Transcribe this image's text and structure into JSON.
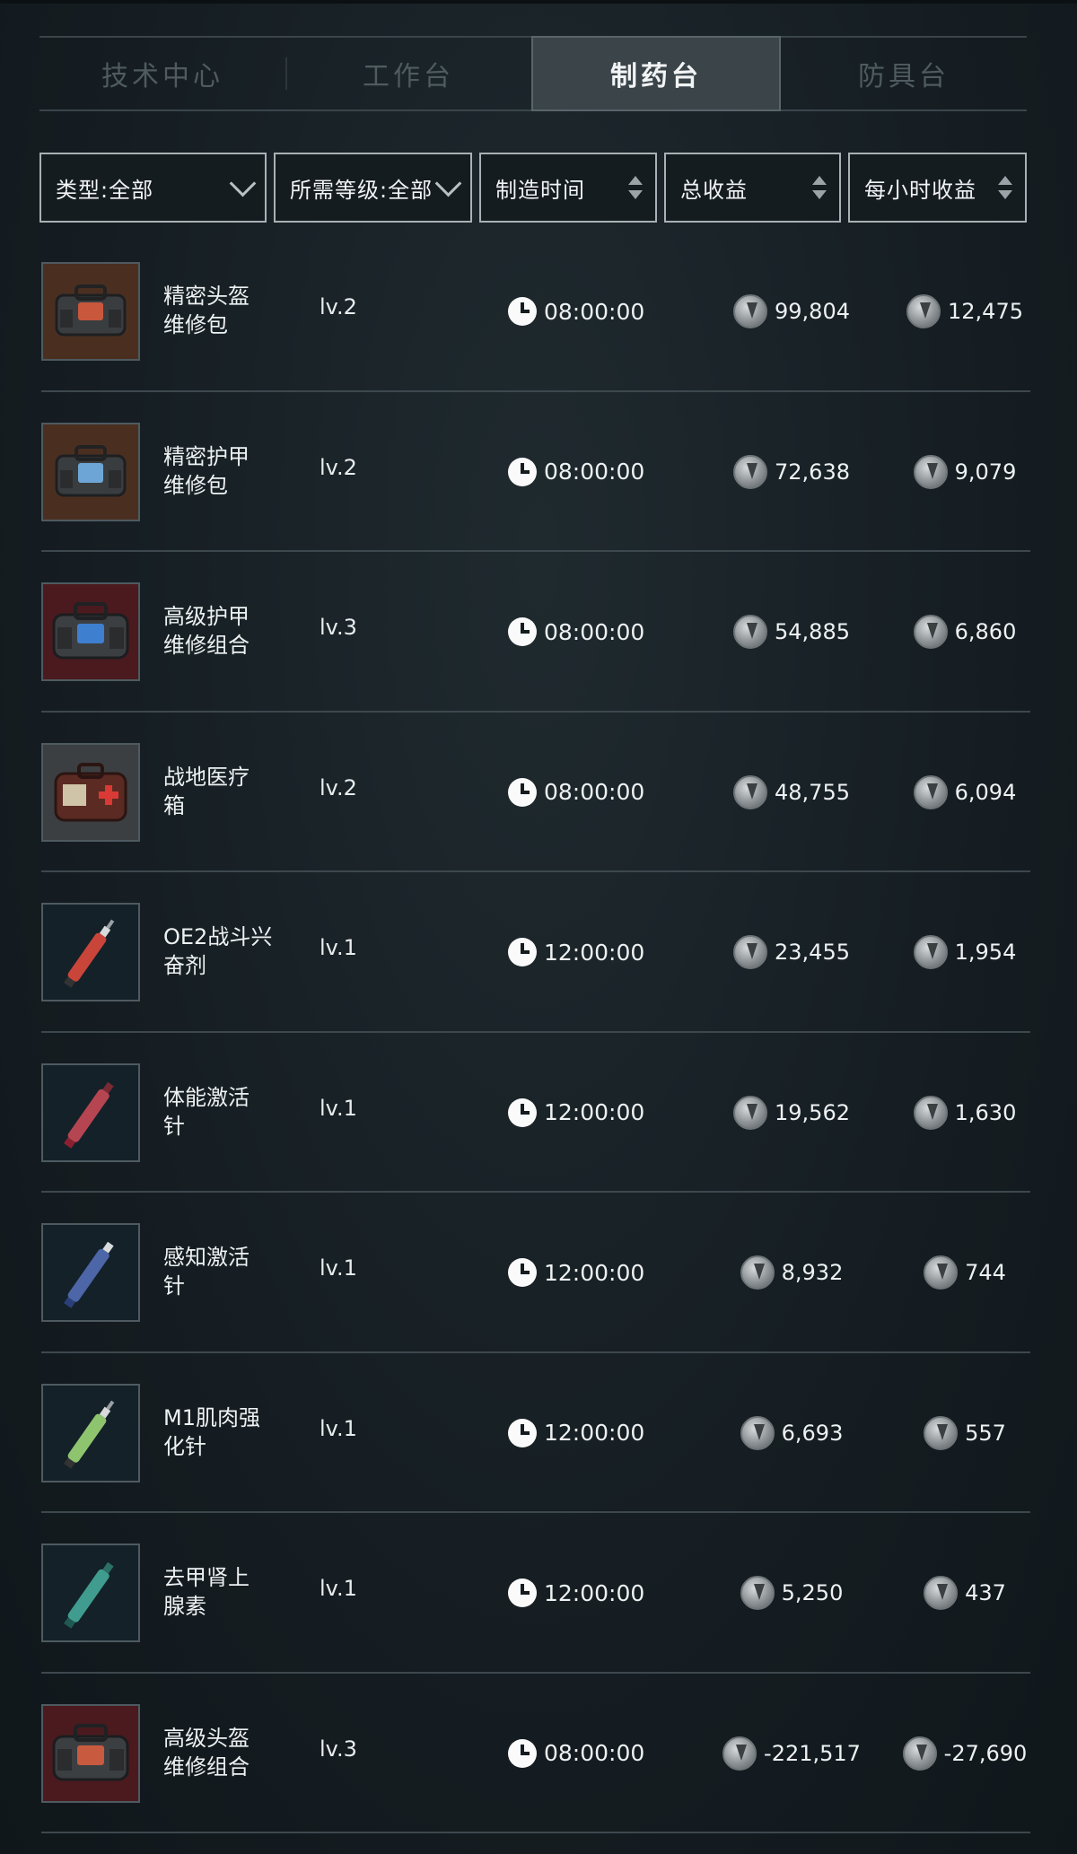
{
  "tabs": [
    {
      "label": "技术中心",
      "active": false
    },
    {
      "label": "工作台",
      "active": false
    },
    {
      "label": "制药台",
      "active": true
    },
    {
      "label": "防具台",
      "active": false
    }
  ],
  "filters": {
    "type": "类型:全部",
    "level": "所需等级:全部",
    "time": "制造时间",
    "total": "总收益",
    "hourly": "每小时收益"
  },
  "items": [
    {
      "name": "精密头盔\n维修包",
      "level": "lv.2",
      "time": "08:00:00",
      "total": "99,804",
      "hourly": "12,475",
      "icon": "bag-icon"
    },
    {
      "name": "精密护甲\n维修包",
      "level": "lv.2",
      "time": "08:00:00",
      "total": "72,638",
      "hourly": "9,079",
      "icon": "bag-icon"
    },
    {
      "name": "高级护甲\n维修组合",
      "level": "lv.3",
      "time": "08:00:00",
      "total": "54,885",
      "hourly": "6,860",
      "icon": "bag-icon"
    },
    {
      "name": "战地医疗\n箱",
      "level": "lv.2",
      "time": "08:00:00",
      "total": "48,755",
      "hourly": "6,094",
      "icon": "medkit-icon"
    },
    {
      "name": "OE2战斗兴\n奋剂",
      "level": "lv.1",
      "time": "12:00:00",
      "total": "23,455",
      "hourly": "1,954",
      "icon": "syringe-icon"
    },
    {
      "name": "体能激活\n针",
      "level": "lv.1",
      "time": "12:00:00",
      "total": "19,562",
      "hourly": "1,630",
      "icon": "syringe-icon"
    },
    {
      "name": "感知激活\n针",
      "level": "lv.1",
      "time": "12:00:00",
      "total": "8,932",
      "hourly": "744",
      "icon": "syringe-icon"
    },
    {
      "name": "M1肌肉强\n化针",
      "level": "lv.1",
      "time": "12:00:00",
      "total": "6,693",
      "hourly": "557",
      "icon": "syringe-icon"
    },
    {
      "name": "去甲肾上\n腺素",
      "level": "lv.1",
      "time": "12:00:00",
      "total": "5,250",
      "hourly": "437",
      "icon": "syringe-icon"
    },
    {
      "name": "高级头盔\n维修组合",
      "level": "lv.3",
      "time": "08:00:00",
      "total": "-221,517",
      "hourly": "-27,690",
      "icon": "bag-icon"
    }
  ]
}
